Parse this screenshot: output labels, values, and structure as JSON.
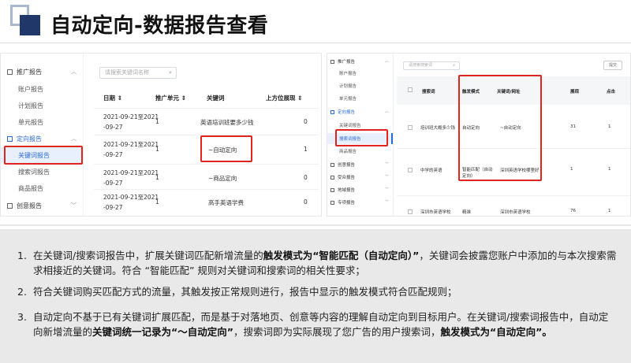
{
  "header": {
    "title": "自动定向-数据报告查看"
  },
  "left_panel": {
    "nav": [
      {
        "label": "推广报告",
        "type": "group"
      },
      {
        "label": "账户报告",
        "type": "item"
      },
      {
        "label": "计划报告",
        "type": "item"
      },
      {
        "label": "单元报告",
        "type": "item"
      },
      {
        "label": "定向报告",
        "type": "group-active"
      },
      {
        "label": "关键词报告",
        "type": "selected"
      },
      {
        "label": "搜索词报告",
        "type": "item"
      },
      {
        "label": "商品报告",
        "type": "item"
      },
      {
        "label": "创意报告",
        "type": "group"
      }
    ],
    "search_placeholder": "请搜索关键词名称",
    "columns": [
      "日期",
      "推广单元",
      "关键词",
      "上方位展现"
    ],
    "rows": [
      {
        "date_l1": "2021-09-21至2021",
        "date_l2": "-09-27",
        "unit": "1",
        "keyword": "英语培训班要多少钱",
        "views": "0"
      },
      {
        "date_l1": "2021-09-21至2021",
        "date_l2": "-09-27",
        "unit": "1",
        "keyword": "~自动定向",
        "views": "1"
      },
      {
        "date_l1": "2021-09-21至2021",
        "date_l2": "-09-27",
        "unit": "1",
        "keyword": "~商品定向",
        "views": "0"
      },
      {
        "date_l1": "2021-09-21至2021",
        "date_l2": "-09-27",
        "unit": "1",
        "keyword": "高手英语学费",
        "views": "0"
      }
    ]
  },
  "right_panel": {
    "nav": [
      {
        "label": "推广报告",
        "type": "group"
      },
      {
        "label": "账户报告",
        "type": "item"
      },
      {
        "label": "计划报告",
        "type": "item"
      },
      {
        "label": "单元报告",
        "type": "item"
      },
      {
        "label": "定向报告",
        "type": "group-active"
      },
      {
        "label": "关键词报告",
        "type": "item"
      },
      {
        "label": "搜索词报告",
        "type": "selected"
      },
      {
        "label": "商品报告",
        "type": "item"
      },
      {
        "label": "创意报告",
        "type": "group"
      },
      {
        "label": "受众报告",
        "type": "group"
      },
      {
        "label": "地域报告",
        "type": "group"
      },
      {
        "label": "专项报告",
        "type": "group"
      }
    ],
    "search_placeholder": "请搜索搜索词",
    "button": "提交",
    "columns": [
      "搜索词",
      "触发模式",
      "关键词/网址",
      "展现",
      "点击"
    ],
    "rows": [
      {
        "term": "培训班大概多少钱",
        "mode": "自动定向",
        "keyword": "~自动定向",
        "views": "31",
        "clicks": "1"
      },
      {
        "term": "中学的英语",
        "mode": "智能匹配（自动定向）",
        "keyword": "深圳英语学校哪里好",
        "views": "1",
        "clicks": "1"
      },
      {
        "term": "深圳市英语学校",
        "mode": "精准",
        "keyword": "深圳市英语学校",
        "views": "76",
        "clicks": "1"
      }
    ]
  },
  "notes": [
    {
      "num": "1.",
      "parts": [
        {
          "t": "在关键词/搜索词报告中，扩展关键词匹配新增流量的",
          "b": false
        },
        {
          "t": "触发模式为“智能匹配（自动定向）”",
          "b": true
        },
        {
          "t": "，关键词会披露您账户中添加的与本次搜索需求相接近的关键词。符合 “智能匹配” 规则对关键词和搜索词的相关性要求；",
          "b": false
        }
      ]
    },
    {
      "num": "2.",
      "parts": [
        {
          "t": "符合关键词购买匹配方式的流量，其触发按正常规则进行，报告中显示的触发模式符合匹配规则；",
          "b": false
        }
      ]
    },
    {
      "num": "3.",
      "parts": [
        {
          "t": "自动定向不基于已有关键词扩展匹配，而是基于对落地页、创意等内容的理解自动定向到目标用户。在关键词/搜索词报告中，自动定向新增流量的",
          "b": false
        },
        {
          "t": "关键词统一记录为“～自动定向”",
          "b": true
        },
        {
          "t": "，搜索词即为实际展现了您广告的用户搜索词，",
          "b": false
        },
        {
          "t": "触发模式为“自动定向”。",
          "b": true
        }
      ]
    }
  ],
  "colors": {
    "highlight_red": "#e0241e",
    "accent_blue": "#2b6bd8",
    "logo_navy": "#1f3769"
  }
}
